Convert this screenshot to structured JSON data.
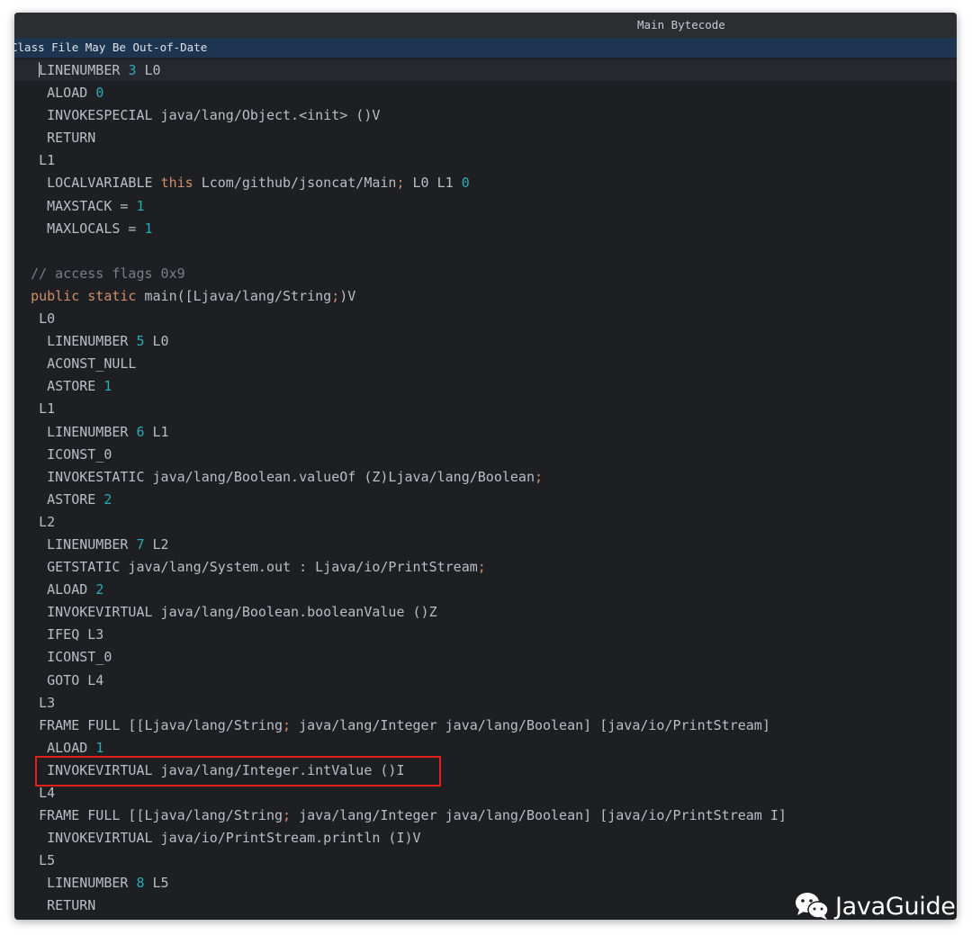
{
  "window": {
    "title": "Main Bytecode"
  },
  "banner": {
    "text": "Class File May Be Out-of-Date"
  },
  "watermark": {
    "icon": "wechat-icon",
    "text": "JavaGuide"
  },
  "colors": {
    "background": "#1e1f22",
    "text": "#bcbec4",
    "keyword": "#cf8e6d",
    "number": "#2aacb8",
    "comment": "#7a7e85",
    "highlight_box": "#e0201b",
    "banner": "#1d3550"
  },
  "code": {
    "lines": [
      [
        [
          "t",
          "   "
        ],
        [
          "c",
          ""
        ],
        [
          "t",
          "LINENUMBER "
        ],
        [
          "n",
          "3"
        ],
        [
          "t",
          " L0"
        ]
      ],
      [
        [
          "t",
          "    ALOAD "
        ],
        [
          "n",
          "0"
        ]
      ],
      [
        [
          "t",
          "    INVOKESPECIAL java/lang/Object.<init> ()V"
        ]
      ],
      [
        [
          "t",
          "    RETURN"
        ]
      ],
      [
        [
          "t",
          "   L1"
        ]
      ],
      [
        [
          "t",
          "    LOCALVARIABLE "
        ],
        [
          "k",
          "this"
        ],
        [
          "t",
          " Lcom/github/jsoncat/Main"
        ],
        [
          "k",
          ";"
        ],
        [
          "t",
          " L0 L1 "
        ],
        [
          "n",
          "0"
        ]
      ],
      [
        [
          "t",
          "    MAXSTACK = "
        ],
        [
          "n",
          "1"
        ]
      ],
      [
        [
          "t",
          "    MAXLOCALS = "
        ],
        [
          "n",
          "1"
        ]
      ],
      [
        [
          "t",
          ""
        ]
      ],
      [
        [
          "m",
          "  // access flags 0x9"
        ]
      ],
      [
        [
          "t",
          "  "
        ],
        [
          "k",
          "public static"
        ],
        [
          "t",
          " main([Ljava/lang/String"
        ],
        [
          "k",
          ";"
        ],
        [
          "t",
          ")V"
        ]
      ],
      [
        [
          "t",
          "   L0"
        ]
      ],
      [
        [
          "t",
          "    LINENUMBER "
        ],
        [
          "n",
          "5"
        ],
        [
          "t",
          " L0"
        ]
      ],
      [
        [
          "t",
          "    ACONST_NULL"
        ]
      ],
      [
        [
          "t",
          "    ASTORE "
        ],
        [
          "n",
          "1"
        ]
      ],
      [
        [
          "t",
          "   L1"
        ]
      ],
      [
        [
          "t",
          "    LINENUMBER "
        ],
        [
          "n",
          "6"
        ],
        [
          "t",
          " L1"
        ]
      ],
      [
        [
          "t",
          "    ICONST_0"
        ]
      ],
      [
        [
          "t",
          "    INVOKESTATIC java/lang/Boolean.valueOf (Z)Ljava/lang/Boolean"
        ],
        [
          "k",
          ";"
        ]
      ],
      [
        [
          "t",
          "    ASTORE "
        ],
        [
          "n",
          "2"
        ]
      ],
      [
        [
          "t",
          "   L2"
        ]
      ],
      [
        [
          "t",
          "    LINENUMBER "
        ],
        [
          "n",
          "7"
        ],
        [
          "t",
          " L2"
        ]
      ],
      [
        [
          "t",
          "    GETSTATIC java/lang/System.out : Ljava/io/PrintStream"
        ],
        [
          "k",
          ";"
        ]
      ],
      [
        [
          "t",
          "    ALOAD "
        ],
        [
          "n",
          "2"
        ]
      ],
      [
        [
          "t",
          "    INVOKEVIRTUAL java/lang/Boolean.booleanValue ()Z"
        ]
      ],
      [
        [
          "t",
          "    IFEQ L3"
        ]
      ],
      [
        [
          "t",
          "    ICONST_0"
        ]
      ],
      [
        [
          "t",
          "    GOTO L4"
        ]
      ],
      [
        [
          "t",
          "   L3"
        ]
      ],
      [
        [
          "t",
          "   FRAME FULL [[Ljava/lang/String"
        ],
        [
          "k",
          ";"
        ],
        [
          "t",
          " java/lang/Integer java/lang/Boolean] [java/io/PrintStream]"
        ]
      ],
      [
        [
          "t",
          "    ALOAD "
        ],
        [
          "n",
          "1"
        ]
      ],
      [
        [
          "t",
          "    INVOKEVIRTUAL java/lang/Integer.intValue ()I"
        ]
      ],
      [
        [
          "t",
          "   L4"
        ]
      ],
      [
        [
          "t",
          "   FRAME FULL [[Ljava/lang/String"
        ],
        [
          "k",
          ";"
        ],
        [
          "t",
          " java/lang/Integer java/lang/Boolean] [java/io/PrintStream I]"
        ]
      ],
      [
        [
          "t",
          "    INVOKEVIRTUAL java/io/PrintStream.println (I)V"
        ]
      ],
      [
        [
          "t",
          "   L5"
        ]
      ],
      [
        [
          "t",
          "    LINENUMBER "
        ],
        [
          "n",
          "8"
        ],
        [
          "t",
          " L5"
        ]
      ],
      [
        [
          "t",
          "    RETURN"
        ]
      ]
    ]
  }
}
